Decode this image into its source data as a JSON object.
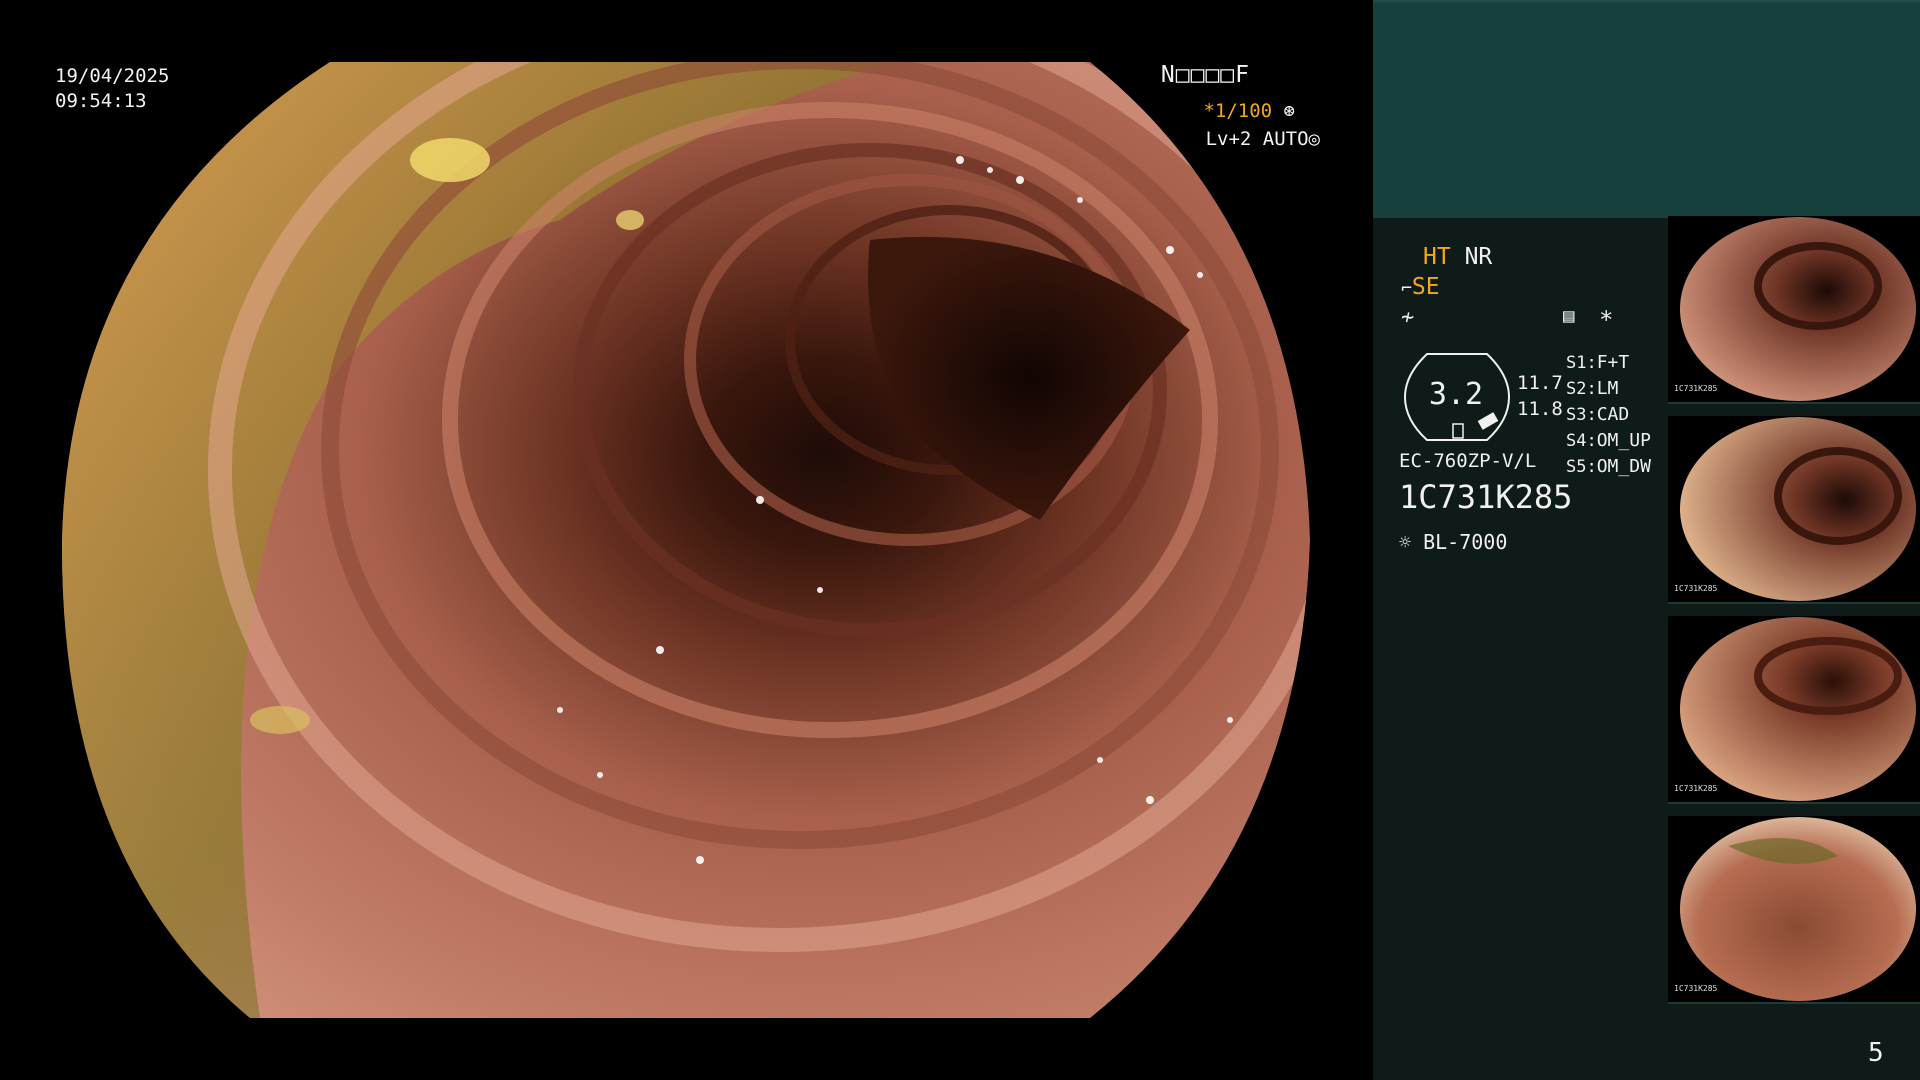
{
  "header": {
    "date": "19/04/2025",
    "time": "09:54:13",
    "patient_code": "N□□□□F",
    "shutter": "*1/100",
    "shutter_icon": "shutter-icon",
    "level": "Lv+2",
    "mode": "AUTO",
    "auto_icon": "auto-exposure-icon"
  },
  "panel": {
    "ht_label": "HT",
    "nr_label": "NR",
    "se_prefix_icon": "edge-enhance-icon",
    "se_label": "SE",
    "filter_icon": "filter-icon",
    "mem_icon": "memory-icon",
    "star": "*",
    "gauge_value": "3.2",
    "gauge_right_top": "11.7",
    "gauge_right_bottom": "11.8",
    "scope_model": "EC-760ZP-V/L",
    "serial": "1C731K285",
    "light_icon": "light-source-icon",
    "light_source": "BL-7000",
    "settings": [
      {
        "key": "S1:",
        "value": "F+T"
      },
      {
        "key": "S2:",
        "value": "LM"
      },
      {
        "key": "S3:",
        "value": "CAD"
      },
      {
        "key": "S4:",
        "value": "OM_UP"
      },
      {
        "key": "S5:",
        "value": "OM_DW"
      }
    ],
    "page_number": "5"
  },
  "thumbnails": [
    {
      "label": "1C731K285"
    },
    {
      "label": "1C731K285"
    },
    {
      "label": "1C731K285"
    },
    {
      "label": "1C731K285"
    }
  ],
  "colors": {
    "amber": "#f0a91c",
    "panel_bg": "#0e1b19",
    "panel_top": "#16403b"
  }
}
